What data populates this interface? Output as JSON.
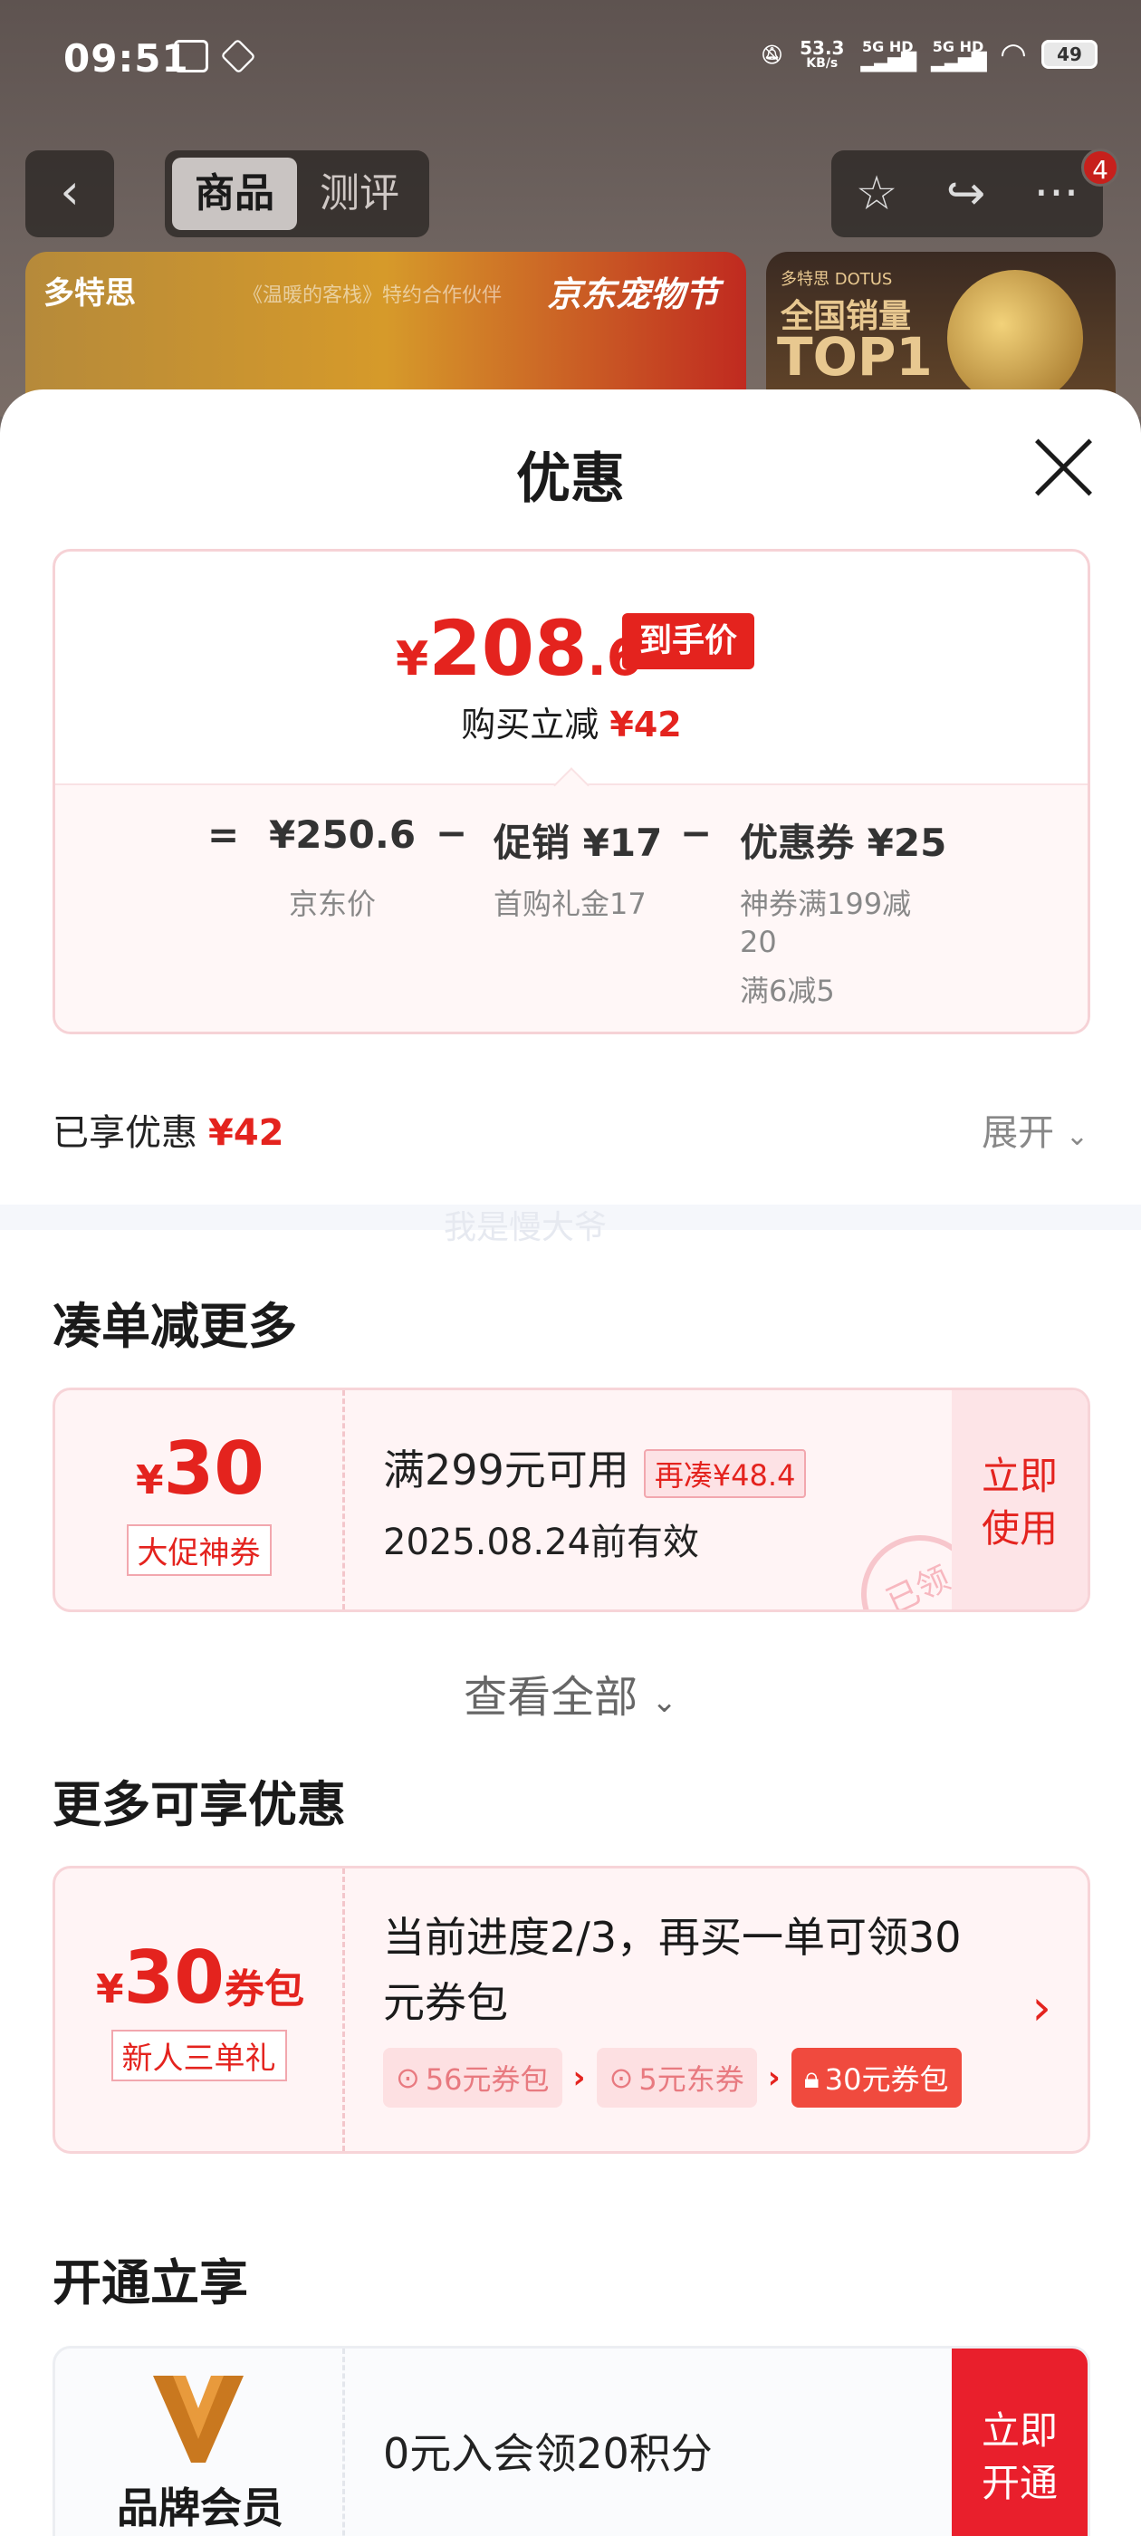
{
  "status_bar": {
    "time": "09:51",
    "speed_value": "53.3",
    "speed_unit": "KB/s",
    "signal1": "5G HD",
    "signal2": "5G HD",
    "battery": "49"
  },
  "nav": {
    "back_icon": "chevron-left-icon",
    "tabs": [
      {
        "label": "商品",
        "active": true
      },
      {
        "label": "测评",
        "active": false
      }
    ],
    "badge_count": "4"
  },
  "banners": {
    "left_brand": "多特思",
    "left_campaign": "京东宠物节",
    "left_sub": "《温暖的客栈》特约合作伙伴",
    "right_brand": "多特思 DOTUS",
    "right_line1": "全国销量",
    "right_line2": "TOP1"
  },
  "sheet": {
    "title": "优惠"
  },
  "price_card": {
    "yen": "¥",
    "final_int": "208",
    "final_dec": ".6",
    "final_tag": "到手价",
    "saved_label": "购买立减",
    "saved_amount": "¥42",
    "equals": "=",
    "minus": "−",
    "jd_price": "¥250.6",
    "jd_price_label": "京东价",
    "promo": "促销 ¥17",
    "promo_label": "首购礼金17",
    "coupon": "优惠券 ¥25",
    "coupon_line1": "神券满199减",
    "coupon_line2": "20",
    "coupon_line3": "满6减5"
  },
  "enjoyed": {
    "label": "已享优惠",
    "amount": "¥42",
    "expand_label": "展开"
  },
  "watermark": "我是慢大爷",
  "section_more_order": {
    "title": "凑单减更多",
    "coupon": {
      "yen": "¥",
      "amount": "30",
      "tag": "大促神券",
      "condition": "满299元可用",
      "extra": "再凑¥48.4",
      "valid": "2025.08.24前有效",
      "button": "立即\n使用",
      "stamp": "已领"
    },
    "view_all": "查看全部"
  },
  "section_more_offers": {
    "title": "更多可享优惠",
    "card": {
      "yen": "¥",
      "amount": "30",
      "suffix": "券包",
      "tag": "新人三单礼",
      "desc_line1": "当前进度2/3，再买一单可领30",
      "desc_line2": "元券包",
      "steps": [
        {
          "label": "56元券包",
          "icon": "check-circle-icon",
          "current": false
        },
        {
          "label": "5元东券",
          "icon": "check-circle-icon",
          "current": false
        },
        {
          "label": "30元券包",
          "icon": "lock-icon",
          "current": true
        }
      ]
    }
  },
  "section_membership": {
    "title": "开通立享",
    "label": "品牌会员",
    "desc": "0元入会领20积分",
    "button_line1": "立即",
    "button_line2": "开通"
  },
  "colors": {
    "accent_red": "#e4231e",
    "sheet_bg": "#ffffff",
    "coupon_bg": "#fff4f5"
  }
}
